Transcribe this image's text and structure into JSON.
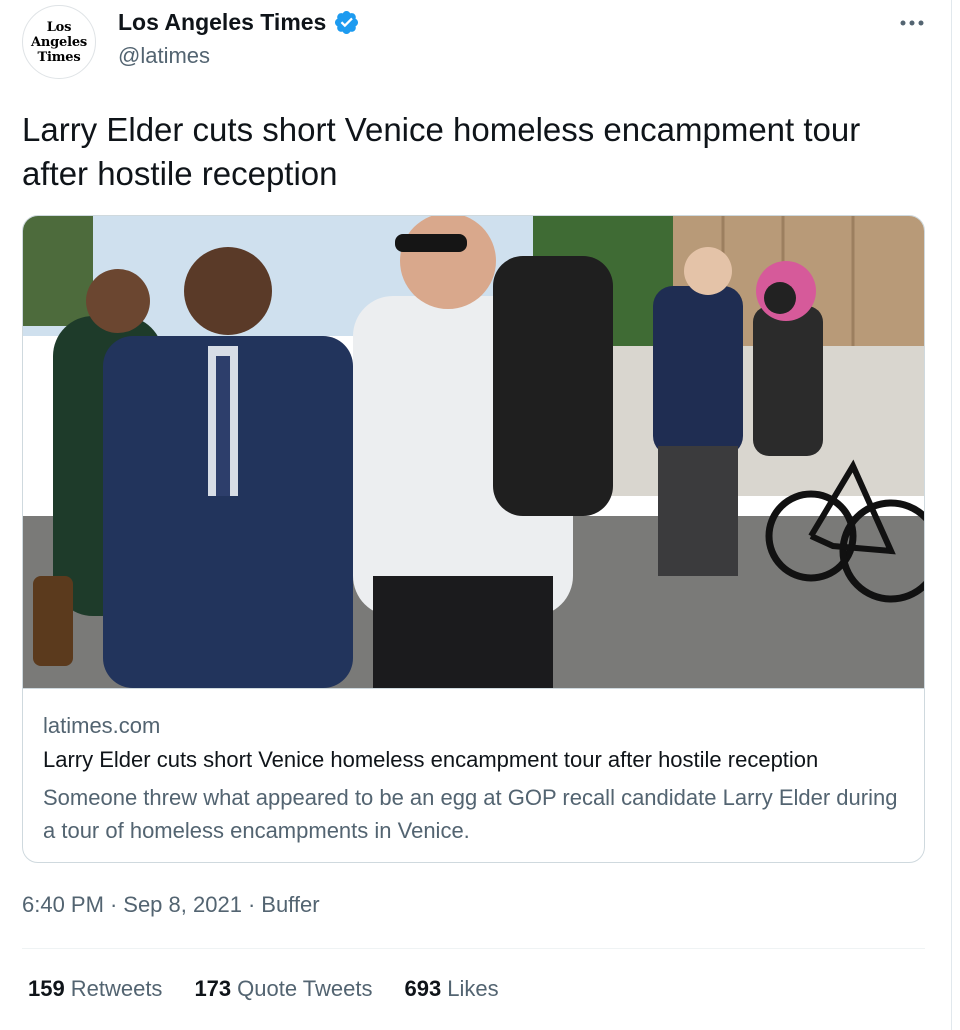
{
  "author": {
    "avatar_text": "Los\nAngeles\nTimes",
    "display_name": "Los Angeles Times",
    "handle": "@latimes",
    "verified": true
  },
  "tweet": {
    "text": "Larry Elder cuts short Venice homeless encampment tour after hostile reception"
  },
  "card": {
    "domain": "latimes.com",
    "title": "Larry Elder cuts short Venice homeless encampment tour after hostile reception",
    "description": "Someone threw what appeared to be an egg at GOP recall candidate Larry Elder during a tour of homeless encampments in Venice."
  },
  "meta": {
    "time": "6:40 PM",
    "date": "Sep 8, 2021",
    "source": "Buffer",
    "separator": "·"
  },
  "stats": {
    "retweets_count": "159",
    "retweets_label": "Retweets",
    "quotes_count": "173",
    "quotes_label": "Quote Tweets",
    "likes_count": "693",
    "likes_label": "Likes"
  },
  "colors": {
    "verified": "#1d9bf0",
    "secondary_text": "#536471",
    "primary_text": "#0f1419",
    "border": "#cfd9de"
  },
  "icons": {
    "verified": "verified-badge-icon",
    "more": "more-options-icon"
  }
}
